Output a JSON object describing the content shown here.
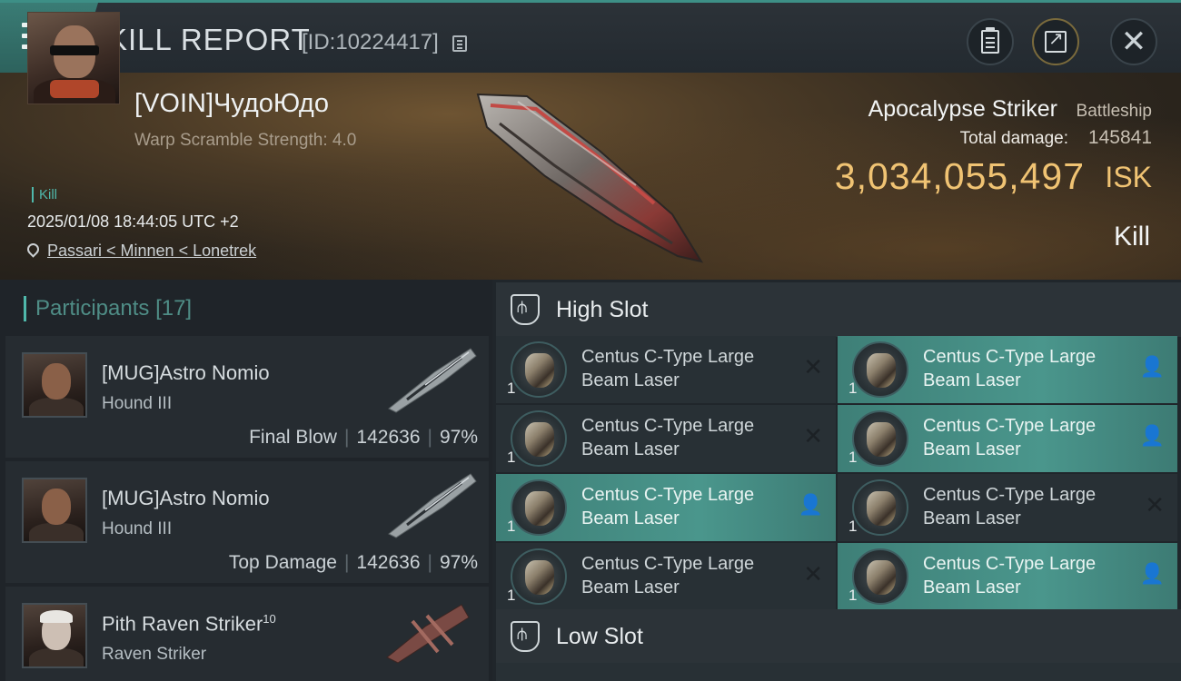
{
  "header": {
    "title": "KILL REPORT",
    "report_id": "[ID:10224417]"
  },
  "icons": {
    "menu": "menu-icon",
    "copy": "copy-icon",
    "clipboard": "clipboard-icon",
    "share": "share-icon",
    "close": "close-icon",
    "location": "location-pin-icon"
  },
  "victim": {
    "pilot": "[VOIN]ЧудоЮдо",
    "warp_scramble": "Warp Scramble Strength: 4.0",
    "kill_tag": "Kill",
    "datetime": "2025/01/08 18:44:05 UTC +2",
    "location": "Passari < Minnen < Lonetrek",
    "ship_name": "Apocalypse Striker",
    "ship_class": "Battleship",
    "total_damage_label": "Total damage:",
    "total_damage": "145841",
    "isk_value": "3,034,055,497",
    "isk_unit": "ISK",
    "result": "Kill"
  },
  "participants": {
    "heading": "Participants",
    "count": "[17]",
    "rows": [
      {
        "name": "[MUG]Astro Nomio",
        "ship": "Hound III",
        "role": "Final Blow",
        "damage": "142636",
        "percent": "97%"
      },
      {
        "name": "[MUG]Astro Nomio",
        "ship": "Hound III",
        "role": "Top Damage",
        "damage": "142636",
        "percent": "97%"
      },
      {
        "name": "Pith Raven Striker",
        "level": "10",
        "ship": "Raven Striker"
      }
    ]
  },
  "slots": {
    "high": {
      "label": "High Slot",
      "modules": [
        {
          "line1": "Centus C-Type Large",
          "line2": "Beam Laser",
          "qty": "1",
          "status": "destroyed"
        },
        {
          "line1": "Centus C-Type Large",
          "line2": "Beam Laser",
          "qty": "1",
          "status": "dropped"
        },
        {
          "line1": "Centus C-Type Large",
          "line2": "Beam Laser",
          "qty": "1",
          "status": "destroyed"
        },
        {
          "line1": "Centus C-Type Large",
          "line2": "Beam Laser",
          "qty": "1",
          "status": "dropped"
        },
        {
          "line1": "Centus C-Type Large",
          "line2": "Beam Laser",
          "qty": "1",
          "status": "dropped"
        },
        {
          "line1": "Centus C-Type Large",
          "line2": "Beam Laser",
          "qty": "1",
          "status": "destroyed"
        },
        {
          "line1": "Centus C-Type Large",
          "line2": "Beam Laser",
          "qty": "1",
          "status": "destroyed"
        },
        {
          "line1": "Centus C-Type Large",
          "line2": "Beam Laser",
          "qty": "1",
          "status": "dropped"
        }
      ]
    },
    "low": {
      "label": "Low Slot"
    }
  },
  "colors": {
    "accent": "#4fb8ab",
    "isk": "#f0c373",
    "dropped_bg": "#4a968c"
  }
}
